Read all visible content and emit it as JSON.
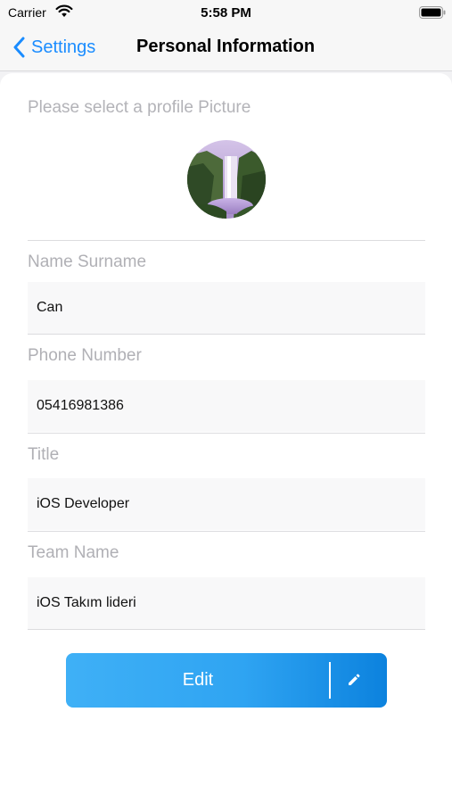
{
  "status_bar": {
    "carrier": "Carrier",
    "time": "5:58 PM",
    "icons": [
      "wifi-icon",
      "battery-icon"
    ]
  },
  "nav": {
    "back_label": "Settings",
    "title": "Personal Information",
    "back_icon": "chevron-left-icon"
  },
  "profile": {
    "prompt": "Please select a profile Picture",
    "avatar_icon": "waterfall-photo"
  },
  "fields": {
    "name": {
      "label": "Name Surname",
      "value": "Can"
    },
    "phone": {
      "label": "Phone Number",
      "value": "05416981386"
    },
    "title": {
      "label": "Title",
      "value": "iOS Developer"
    },
    "team": {
      "label": "Team Name",
      "value": "iOS Takım lideri"
    }
  },
  "edit_button": {
    "label": "Edit",
    "icon": "pencil-icon"
  },
  "colors": {
    "accent": "#1a8cff",
    "button_start": "#3fb0f6",
    "button_end": "#0c82de",
    "label_gray": "#b0b0b5"
  }
}
